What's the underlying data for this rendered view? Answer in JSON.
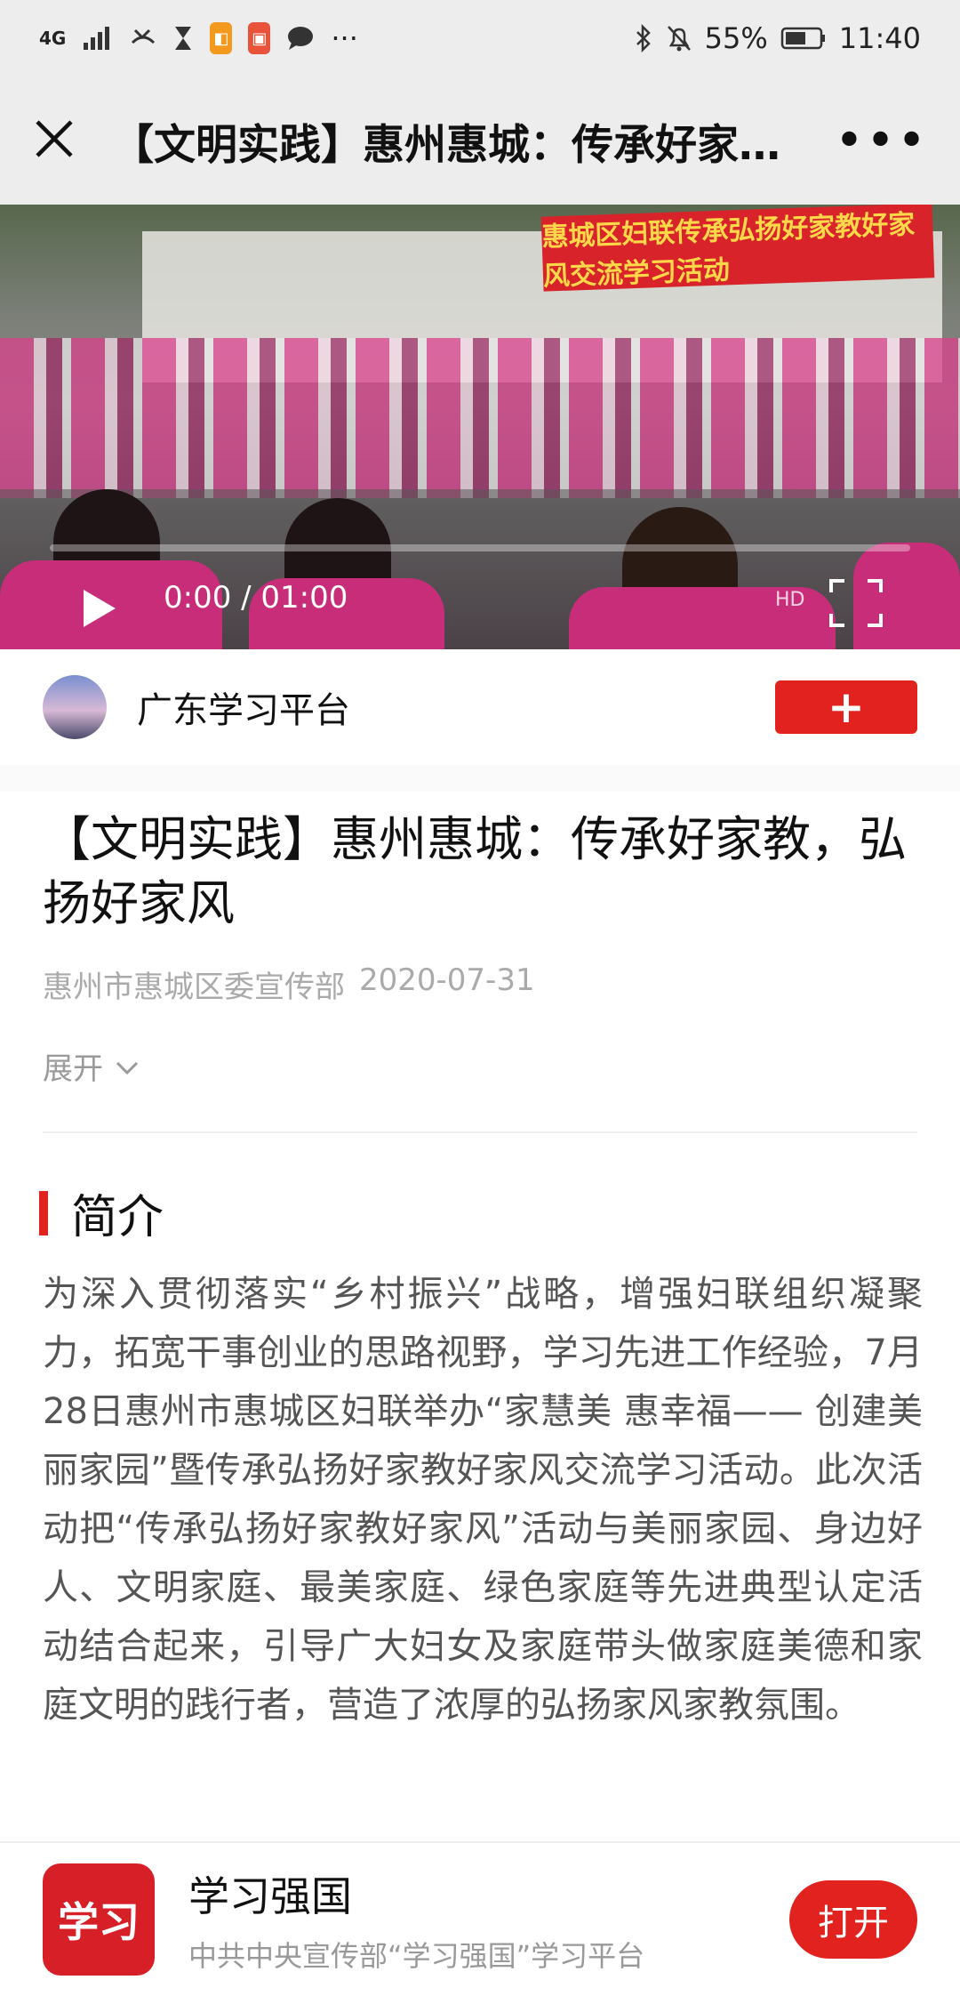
{
  "status_bar": {
    "network": "4G",
    "battery": "55%",
    "time": "11:40",
    "more": "···"
  },
  "title_bar": {
    "title": "【文明实践】惠州惠城：传承好家…",
    "more": "•••"
  },
  "video": {
    "banner": "惠城区妇联传承弘扬好家教好家风交流学习活动",
    "time": "0:00 / 01:00",
    "progress": 0
  },
  "channel": {
    "name": "广东学习平台",
    "follow": "+"
  },
  "article": {
    "title": "【文明实践】惠州惠城：传承好家教，弘扬好家风",
    "source": "惠州市惠城区委宣传部",
    "date": "2020-07-31",
    "expand": "展开",
    "section_title": "简介",
    "body": "为深入贯彻落实“乡村振兴”战略，增强妇联组织凝聚力，拓宽干事创业的思路视野，学习先进工作经验，7月28日惠州市惠城区妇联举办“家慧美 惠幸福—— 创建美丽家园”暨传承弘扬好家教好家风交流学习活动。此次活动把“传承弘扬好家教好家风”活动与美丽家园、身边好人、文明家庭、最美家庭、绿色家庭等先进典型认定活动结合起来，引导广大妇女及家庭带头做家庭美德和家庭文明的践行者，营造了浓厚的弘扬家风家教氛围。"
  },
  "bottom_bar": {
    "logo_text": "学习",
    "app_name": "学习强国",
    "app_sub": "中共中央宣传部“学习强国”学习平台",
    "open": "打开"
  },
  "colors": {
    "accent": "#e1221f",
    "chrome": "#ededed"
  }
}
